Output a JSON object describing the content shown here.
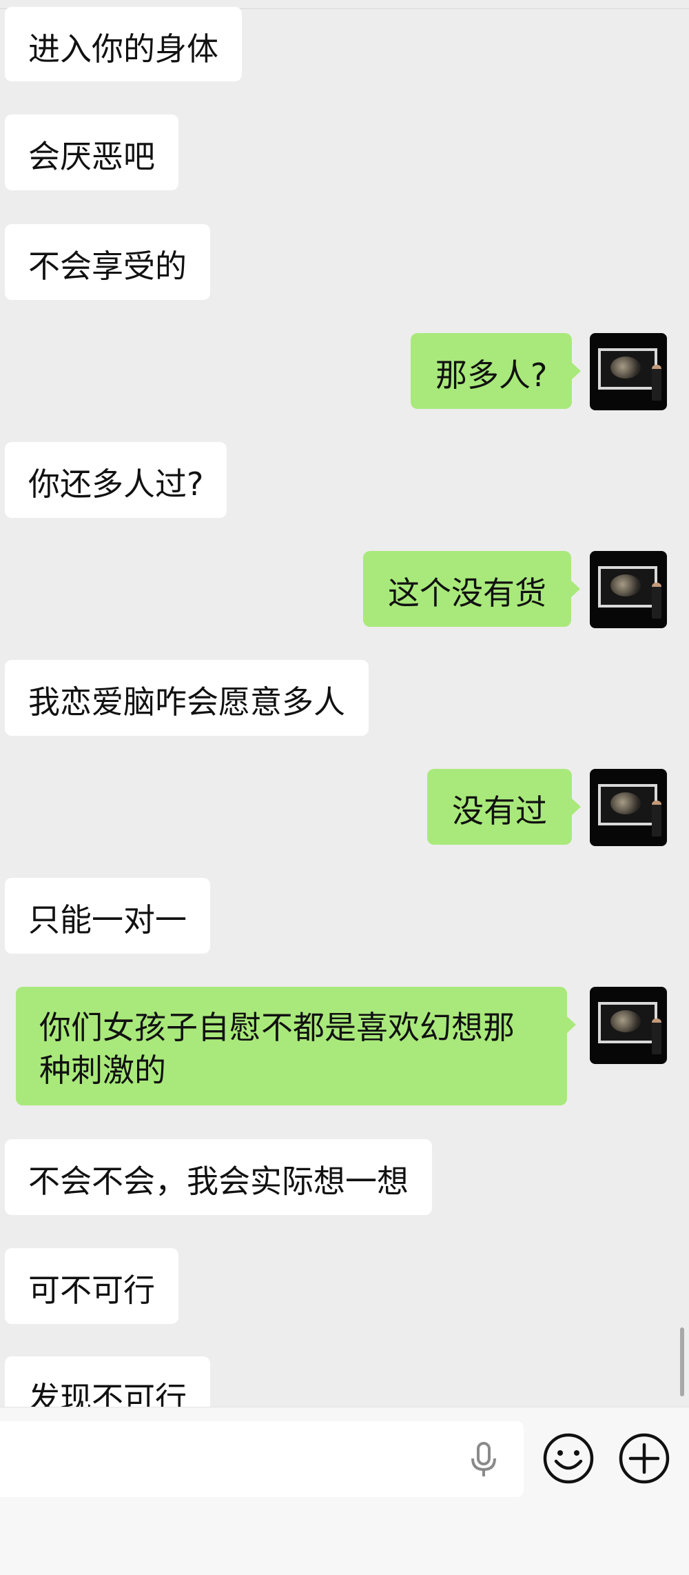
{
  "messages": [
    {
      "side": "in",
      "text": "进入你的身体"
    },
    {
      "side": "in",
      "text": "会厌恶吧"
    },
    {
      "side": "in",
      "text": "不会享受的"
    },
    {
      "side": "out",
      "text": "那多人?"
    },
    {
      "side": "in",
      "text": "你还多人过?"
    },
    {
      "side": "out",
      "text": "这个没有货"
    },
    {
      "side": "in",
      "text": "我恋爱脑咋会愿意多人"
    },
    {
      "side": "out",
      "text": "没有过"
    },
    {
      "side": "in",
      "text": "只能一对一"
    },
    {
      "side": "out",
      "text": "你们女孩子自慰不都是喜欢幻想那种刺激的"
    },
    {
      "side": "in",
      "text": "不会不会，我会实际想一想"
    },
    {
      "side": "in",
      "text": "可不可行"
    },
    {
      "side": "in",
      "text": "发现不可行"
    }
  ],
  "icons": {
    "mic": "microphone-icon",
    "emoji": "smiley-face-icon",
    "more": "plus-circle-icon"
  },
  "colors": {
    "background": "#ededed",
    "incoming_bubble": "#ffffff",
    "outgoing_bubble": "#a9e97b",
    "input_bar": "#f7f7f7"
  }
}
